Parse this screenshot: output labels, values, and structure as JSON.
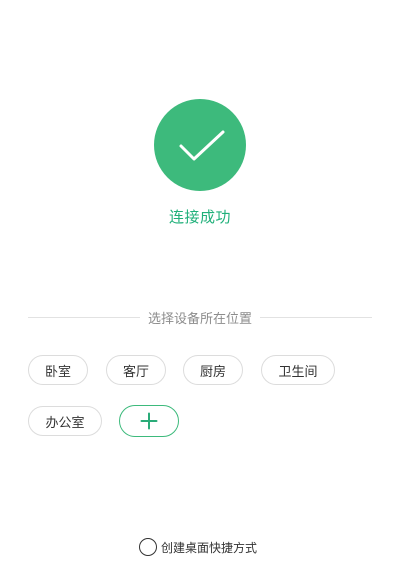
{
  "status": {
    "text": "连接成功",
    "icon": "check-icon",
    "accent_color": "#3dba7c"
  },
  "location": {
    "prompt": "选择设备所在位置",
    "rooms": [
      "卧室",
      "客厅",
      "厨房",
      "卫生间",
      "办公室"
    ],
    "add_icon": "plus-icon"
  },
  "shortcut": {
    "label": "创建桌面快捷方式",
    "checked": false
  }
}
